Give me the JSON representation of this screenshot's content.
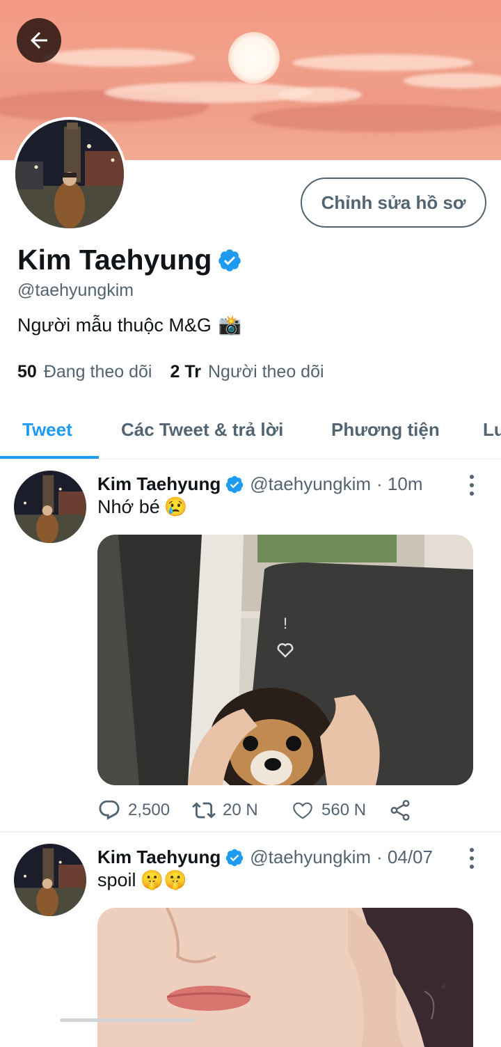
{
  "header": {
    "back_icon": "arrow-left-icon",
    "banner_description_icon": "sunset-banner"
  },
  "profile": {
    "name": "Kim Taehyung",
    "verified_icon": "verified-badge-icon",
    "handle": "@taehyungkim",
    "bio": "Người mẫu thuộc M&G",
    "bio_emoji": "📸",
    "edit_button": "Chỉnh sửa hồ sơ",
    "following_count": "50",
    "following_label": "Đang theo dõi",
    "followers_count": "2 Tr",
    "followers_label": "Người theo dõi"
  },
  "tabs": [
    {
      "label": "Tweet",
      "active": true
    },
    {
      "label": "Các Tweet & trả lời",
      "active": false
    },
    {
      "label": "Phương tiện",
      "active": false
    },
    {
      "label": "Lư",
      "active": false
    }
  ],
  "tweets": [
    {
      "name": "Kim Taehyung",
      "handle": "@taehyungkim",
      "time": "· 10m",
      "text": "Nhớ bé",
      "emoji": "😢",
      "media": "photo-dog",
      "replies": "2,500",
      "retweets": "20 N",
      "likes": "560 N"
    },
    {
      "name": "Kim Taehyung",
      "handle": "@taehyungkim",
      "time": "· 04/07",
      "text": "spoil",
      "emoji": "🤫🤫",
      "media": "photo-portrait"
    }
  ],
  "colors": {
    "accent": "#1d9bf0",
    "secondary_text": "#536471",
    "banner": "#f1a08a"
  }
}
